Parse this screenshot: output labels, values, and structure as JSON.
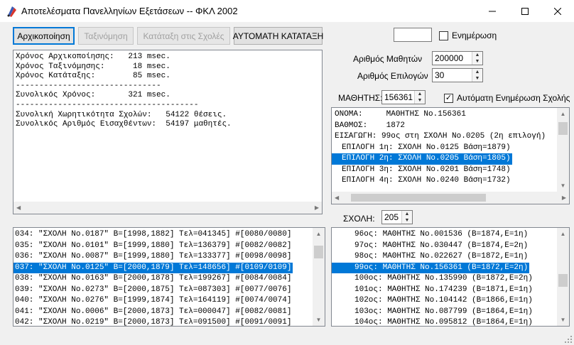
{
  "window": {
    "title": "Αποτελέσματα Πανελληνίων Εξετάσεων -- ΦΚΛ 2002",
    "minimize": "—",
    "maximize": "☐",
    "close": "✕"
  },
  "toolbar": {
    "init": "Αρχικοποίηση",
    "sort": "Ταξινόμηση",
    "rank": "Κατάταξη στις Σχολές",
    "auto": "ΑΥΤΟΜΑΤΗ ΚΑΤΑΤΑΞΗ"
  },
  "update": {
    "value": "",
    "label": "Ενημέρωση",
    "checked": false
  },
  "log_lines": [
    "Χρόνος Αρχικοποίησης:   213 msec.",
    "Χρόνος Ταξινόμησης:      18 msec.",
    "Χρόνος Κατάταξης:        85 msec.",
    "-------------------------------",
    "Συνολικός Χρόνος:       321 msec.",
    "---------------------------------------",
    "Συνολική Χωρητικότητα Σχολών:   54122 θέσεις.",
    "Συνολικός Αριθμός Εισαχθέντων:  54197 μαθητές."
  ],
  "params": {
    "students_label": "Αριθμός Μαθητών",
    "students_value": "200000",
    "choices_label": "Αριθμός Επιλογών",
    "choices_value": "30"
  },
  "student": {
    "label": "ΜΑΘΗΤΗΣ:",
    "value": "156361",
    "auto_label": "Αυτόματη Ενημέρωση Σχολής",
    "auto_checked": true
  },
  "student_info": {
    "lines": [
      {
        "text": "ΟΝΟΜΑ:     ΜΑΘΗΤΗΣ No.156361",
        "indent": false,
        "selected": false
      },
      {
        "text": "ΒΑΘΜΟΣ:    1872",
        "indent": false,
        "selected": false
      },
      {
        "text": "ΕΙΣΑΓΩΓΗ: 99ος στη ΣΧΟΛΗ No.0205 (2η επιλογή)",
        "indent": false,
        "selected": false
      },
      {
        "text": "ΕΠΙΛΟΓΗ 1η: ΣΧΟΛΗ No.0125 Βάση=1879)",
        "indent": true,
        "selected": false
      },
      {
        "text": "ΕΠΙΛΟΓΗ 2η: ΣΧΟΛΗ No.0205 Βάση=1805)",
        "indent": true,
        "selected": true
      },
      {
        "text": "ΕΠΙΛΟΓΗ 3η: ΣΧΟΛΗ No.0201 Βάση=1748)",
        "indent": true,
        "selected": false
      },
      {
        "text": "ΕΠΙΛΟΓΗ 4η: ΣΧΟΛΗ No.0240 Βάση=1732)",
        "indent": true,
        "selected": false
      }
    ]
  },
  "school": {
    "label": "ΣΧΟΛΗ:",
    "value": "205"
  },
  "schools_list": [
    {
      "text": "034: \"ΣΧΟΛΗ No.0187\" B=[1998,1882] Tελ=041345] #[0080/0080]",
      "selected": false
    },
    {
      "text": "035: \"ΣΧΟΛΗ No.0101\" B=[1999,1880] Tελ=136379] #[0082/0082]",
      "selected": false
    },
    {
      "text": "036: \"ΣΧΟΛΗ No.0087\" B=[1999,1880] Tελ=133377] #[0098/0098]",
      "selected": false
    },
    {
      "text": "037: \"ΣΧΟΛΗ No.0125\" B=[2000,1879] Tελ=148656] #[0109/0109]",
      "selected": true
    },
    {
      "text": "038: \"ΣΧΟΛΗ No.0163\" B=[2000,1878] Tελ=199267] #[0084/0084]",
      "selected": false
    },
    {
      "text": "039: \"ΣΧΟΛΗ No.0273\" B=[2000,1875] Tελ=087303] #[0077/0076]",
      "selected": false
    },
    {
      "text": "040: \"ΣΧΟΛΗ No.0276\" B=[1999,1874] Tελ=164119] #[0074/0074]",
      "selected": false
    },
    {
      "text": "041: \"ΣΧΟΛΗ No.0006\" B=[2000,1873] Tελ=000047] #[0082/0081]",
      "selected": false
    },
    {
      "text": "042: \"ΣΧΟΛΗ No.0219\" B=[2000,1873] Tελ=091500] #[0091/0091]",
      "selected": false
    }
  ],
  "school_students": [
    {
      "text": "96ος: ΜΑΘΗΤΗΣ No.001536 (B=1874,E=1η)",
      "selected": false
    },
    {
      "text": "97ος: ΜΑΘΗΤΗΣ No.030447 (B=1874,E=2η)",
      "selected": false
    },
    {
      "text": "98ος: ΜΑΘΗΤΗΣ No.022627 (B=1872,E=1η)",
      "selected": false
    },
    {
      "text": "99ος: ΜΑΘΗΤΗΣ No.156361 (B=1872,E=2η)",
      "selected": true
    },
    {
      "text": "100ος: ΜΑΘΗΤΗΣ No.135990 (B=1872,E=2η)",
      "selected": false
    },
    {
      "text": "101ος: ΜΑΘΗΤΗΣ No.174239 (B=1871,E=1η)",
      "selected": false
    },
    {
      "text": "102ος: ΜΑΘΗΤΗΣ No.104142 (B=1866,E=1η)",
      "selected": false
    },
    {
      "text": "103ος: ΜΑΘΗΤΗΣ No.087799 (B=1864,E=1η)",
      "selected": false
    },
    {
      "text": "104ος: ΜΑΘΗΤΗΣ No.095812 (B=1864,E=1η)",
      "selected": false
    }
  ],
  "colors": {
    "selection": "#0078d7",
    "selection_text": "#ffffff",
    "disabled_text": "#a0a0a0"
  }
}
